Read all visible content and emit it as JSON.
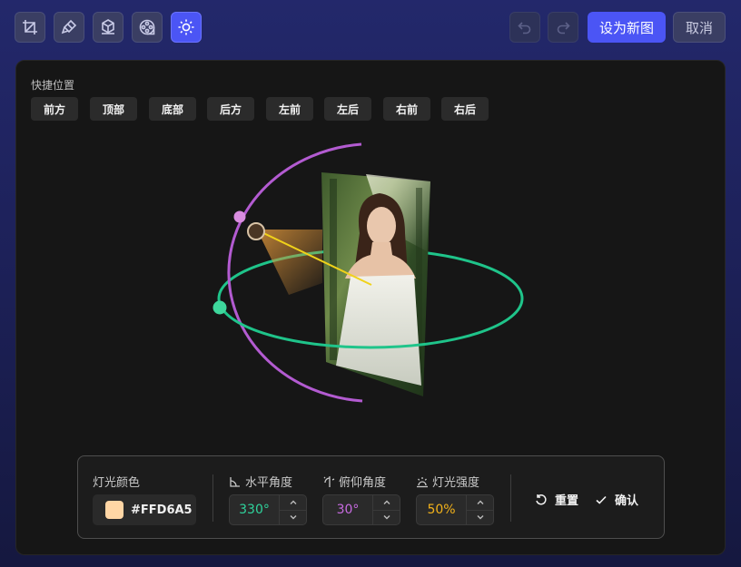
{
  "toolbar": {
    "tools": [
      {
        "name": "crop-icon",
        "active": false
      },
      {
        "name": "brush-icon",
        "active": false
      },
      {
        "name": "cube-icon",
        "active": false
      },
      {
        "name": "film-reel-icon",
        "active": false
      },
      {
        "name": "sun-icon",
        "active": true
      }
    ],
    "undo_icon": "undo-icon",
    "redo_icon": "redo-icon",
    "primary_label": "设为新图",
    "cancel_label": "取消"
  },
  "quick_positions": {
    "title": "快捷位置",
    "items": [
      "前方",
      "顶部",
      "底部",
      "后方",
      "左前",
      "左后",
      "右前",
      "右后"
    ]
  },
  "light": {
    "color_label": "灯光颜色",
    "color_hex": "#FFD6A5",
    "horizontal_label": "水平角度",
    "horizontal_value": "330°",
    "pitch_label": "俯仰角度",
    "pitch_value": "30°",
    "intensity_label": "灯光强度",
    "intensity_value": "50%",
    "reset_label": "重置",
    "confirm_label": "确认"
  },
  "colors": {
    "accent": "#4B55F5",
    "horizontal_ring": "#1FC48A",
    "vertical_ring": "#B35BD1",
    "light_beam": "#F0D21A",
    "horizontal_value": "#2FD39C",
    "pitch_value": "#C76BE0",
    "intensity_value": "#F2B21A"
  }
}
